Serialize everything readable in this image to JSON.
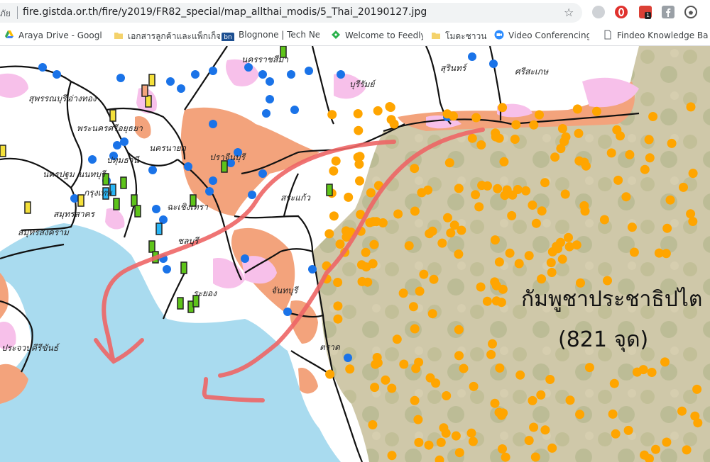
{
  "address_bar": {
    "prefix": "ภัย",
    "url": "fire.gistda.or.th/fire/y2019/FR82_special/map_allthai_modis/5_Thai_20190127.jpg",
    "extension_badge": "1"
  },
  "bookmarks": [
    {
      "label": "Araya Drive - Google",
      "icon": "google-drive-icon"
    },
    {
      "label": "เอกสารลูกค้าและแพ็กเก็จ",
      "icon": "folder-icon"
    },
    {
      "label": "Blognone | Tech New",
      "icon": "blognone-icon",
      "icon_text": "bn"
    },
    {
      "label": "Welcome to Feedly",
      "icon": "feedly-icon"
    },
    {
      "label": "โมดะชาวน",
      "icon": "folder-icon"
    },
    {
      "label": "Video Conferencing,",
      "icon": "video-camera-icon"
    },
    {
      "label": "Findeo Knowledge Ba",
      "icon": "document-icon"
    }
  ],
  "map": {
    "province_labels": [
      {
        "text": "สุพรรณบุรี"
      },
      {
        "text": "อ่างทอง"
      },
      {
        "text": "พระนครศรีอยุธยา"
      },
      {
        "text": "ปทุมธานี"
      },
      {
        "text": "นครนายก"
      },
      {
        "text": "ปราจีนบุรี"
      },
      {
        "text": "นครปฐม"
      },
      {
        "text": "นนทบุรี"
      },
      {
        "text": "กรุงเทพ"
      },
      {
        "text": "สมุทรสาคร"
      },
      {
        "text": "สมุทรสงคราม"
      },
      {
        "text": "ฉะเชิงเทรา"
      },
      {
        "text": "ชลบุรี"
      },
      {
        "text": "ระยอง"
      },
      {
        "text": "จันทบุรี"
      },
      {
        "text": "สระแก้ว"
      },
      {
        "text": "ตราด"
      },
      {
        "text": "บุรีรัมย์"
      },
      {
        "text": "สุรินทร์"
      },
      {
        "text": "ศรีสะเกษ"
      },
      {
        "text": "นครราชสีมา"
      },
      {
        "text": "ประจวบคีรีขันธ์"
      }
    ],
    "country_label": "กัมพูชาประชาธิปไต",
    "hotspot_count_label": "(821 จุด)",
    "colors": {
      "sea": "#a9dbef",
      "land": "#ffffff",
      "cambodia": "#cdc6a8",
      "forest": "#f3a37c",
      "farmland": "#f7c0ea",
      "hotspot_thailand": "#1a73e8",
      "hotspot_cambodia": "#ffa500",
      "arrows": "#ee6666",
      "flag_green": "#5ec41a",
      "flag_yellow": "#f4e03a",
      "flag_cyan": "#29b6f6"
    }
  }
}
